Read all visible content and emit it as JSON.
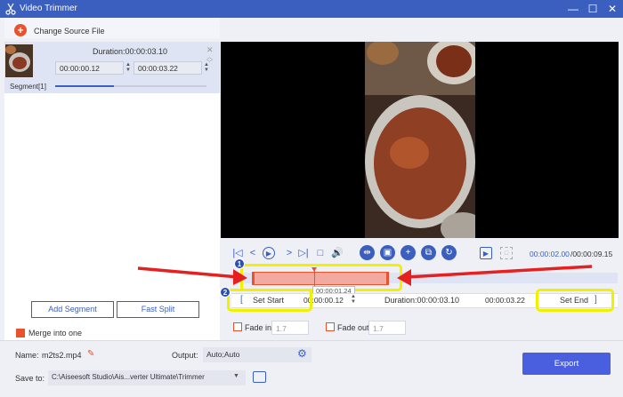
{
  "window": {
    "title": "Video Trimmer",
    "controls": [
      "—",
      "☐",
      "✕"
    ]
  },
  "toolbar": {
    "change_source": "Change Source File"
  },
  "segment": {
    "duration": "Duration:00:00:03.10",
    "start": "00:00:00.12",
    "end": "00:00:03.22",
    "label": "Segment[1]"
  },
  "left_actions": {
    "add_segment": "Add Segment",
    "fast_split": "Fast Split",
    "merge": "Merge into one"
  },
  "player": {
    "current_time": "00:00:02.00",
    "total_time": "/00:00:09.15",
    "hover_time": "00:00:01.24"
  },
  "trim": {
    "set_start": "Set Start",
    "start_value": "00:00:00.12",
    "duration": "Duration:00:00:03.10",
    "end_value": "00:00:03.22",
    "set_end": "Set End",
    "fade_in_label": "Fade in",
    "fade_in_value": "1.7",
    "fade_out_label": "Fade out",
    "fade_out_value": "1.7"
  },
  "annotations": {
    "badge1": "1",
    "badge2": "2"
  },
  "output": {
    "name_label": "Name:",
    "name_value": "m2ts2.mp4",
    "output_label": "Output:",
    "output_value": "Auto;Auto",
    "save_label": "Save to:",
    "save_value": "C:\\Aiseesoft Studio\\Ais...verter Ultimate\\Trimmer",
    "export": "Export"
  },
  "colors": {
    "accent": "#3b5fbe",
    "orange": "#e8522d",
    "highlight": "#f0f000",
    "export": "#4a5fe0"
  }
}
